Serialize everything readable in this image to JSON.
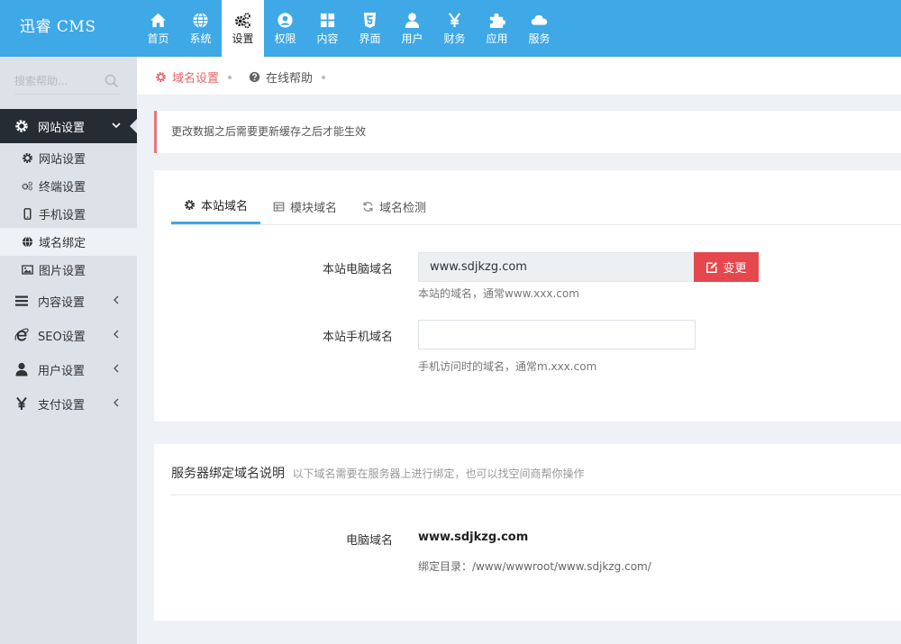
{
  "brand": {
    "title": "迅睿 CMS"
  },
  "topnav": [
    {
      "label": "首页",
      "icon": "home-icon"
    },
    {
      "label": "系统",
      "icon": "globe-icon"
    },
    {
      "label": "设置",
      "icon": "gears-icon"
    },
    {
      "label": "权限",
      "icon": "user-circle-icon"
    },
    {
      "label": "内容",
      "icon": "grid-icon"
    },
    {
      "label": "界面",
      "icon": "html5-icon"
    },
    {
      "label": "用户",
      "icon": "user-icon"
    },
    {
      "label": "财务",
      "icon": "yen-icon"
    },
    {
      "label": "应用",
      "icon": "puzzle-icon"
    },
    {
      "label": "服务",
      "icon": "cloud-icon"
    }
  ],
  "sidebar": {
    "search_placeholder": "搜索帮助...",
    "groups": [
      {
        "label": "网站设置",
        "icon": "gear-icon"
      },
      {
        "label": "内容设置",
        "icon": "list-icon"
      },
      {
        "label": "SEO设置",
        "icon": "ie-icon"
      },
      {
        "label": "用户设置",
        "icon": "user-icon"
      },
      {
        "label": "支付设置",
        "icon": "yen-icon"
      }
    ],
    "sub_items": [
      {
        "label": "网站设置",
        "icon": "gear-icon"
      },
      {
        "label": "终端设置",
        "icon": "gears-icon"
      },
      {
        "label": "手机设置",
        "icon": "mobile-icon"
      },
      {
        "label": "域名绑定",
        "icon": "globe-icon"
      },
      {
        "label": "图片设置",
        "icon": "image-icon"
      }
    ]
  },
  "breadcrumb": {
    "current": "域名设置",
    "help": "在线帮助"
  },
  "alert": {
    "text": "更改数据之后需要更新缓存之后才能生效"
  },
  "tabs": [
    {
      "label": "本站域名",
      "icon": "gear-icon"
    },
    {
      "label": "模块域名",
      "icon": "table-icon"
    },
    {
      "label": "域名检测",
      "icon": "refresh-icon"
    }
  ],
  "form": {
    "pc_label": "本站电脑域名",
    "pc_value": "www.sdjkzg.com",
    "change_label": "变更",
    "pc_help": "本站的域名，通常www.xxx.com",
    "mobile_label": "本站手机域名",
    "mobile_value": "",
    "mobile_help": "手机访问时的域名，通常m.xxx.com"
  },
  "server": {
    "title": "服务器绑定域名说明",
    "subtitle": "以下域名需要在服务器上进行绑定，也可以找空间商帮你操作",
    "pc_label": "电脑域名",
    "pc_value": "www.sdjkzg.com",
    "dir_text": "绑定目录：/www/wwwroot/www.sdjkzg.com/"
  },
  "colors": {
    "topbar": "#3fa8e6",
    "sidebar_active": "#262c33",
    "danger": "#e5474d",
    "alert_border": "#e9767a"
  }
}
